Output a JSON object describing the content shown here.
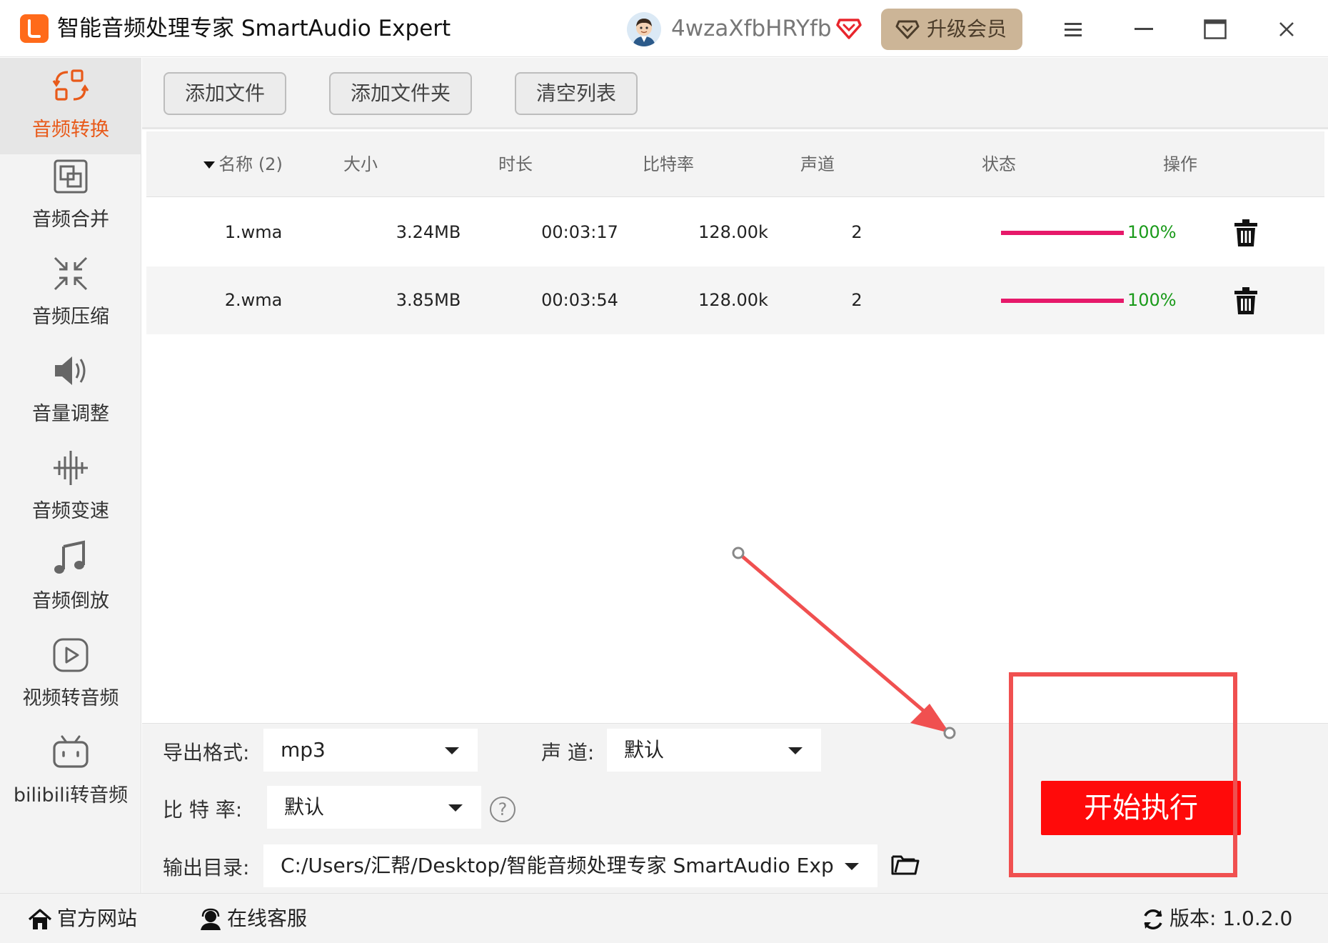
{
  "titlebar": {
    "app_title": "智能音频处理专家 SmartAudio Expert",
    "username": "4wzaXfbHRYfb",
    "upgrade_label": "升级会员"
  },
  "sidebar": {
    "items": [
      {
        "label": "音频转换",
        "icon": "convert-icon",
        "active": true
      },
      {
        "label": "音频合并",
        "icon": "merge-icon"
      },
      {
        "label": "音频压缩",
        "icon": "compress-icon"
      },
      {
        "label": "音量调整",
        "icon": "volume-icon"
      },
      {
        "label": "音频变速",
        "icon": "speed-icon"
      },
      {
        "label": "音频倒放",
        "icon": "music-note-icon"
      },
      {
        "label": "视频转音频",
        "icon": "video-play-icon"
      },
      {
        "label": "bilibili转音频",
        "icon": "bilibili-tv-icon"
      }
    ]
  },
  "toolbar": {
    "add_file": "添加文件",
    "add_folder": "添加文件夹",
    "clear_list": "清空列表"
  },
  "table": {
    "headers": {
      "name": "名称 (2)",
      "size": "大小",
      "duration": "时长",
      "bitrate": "比特率",
      "channels": "声道",
      "status": "状态",
      "action": "操作"
    },
    "rows": [
      {
        "name": "1.wma",
        "size": "3.24MB",
        "duration": "00:03:17",
        "bitrate": "128.00k",
        "channels": "2",
        "progress": 100,
        "progress_text": "100%"
      },
      {
        "name": "2.wma",
        "size": "3.85MB",
        "duration": "00:03:54",
        "bitrate": "128.00k",
        "channels": "2",
        "progress": 100,
        "progress_text": "100%"
      }
    ]
  },
  "settings": {
    "format_label": "导出格式:",
    "format_value": "mp3",
    "channel_label": "声 道:",
    "channel_value": "默认",
    "bitrate_label": "比 特 率:",
    "bitrate_value": "默认",
    "output_label": "输出目录:",
    "output_value": "C:/Users/汇帮/Desktop/智能音频处理专家 SmartAudio Exp",
    "start_label": "开始执行"
  },
  "statusbar": {
    "website": "官方网站",
    "support": "在线客服",
    "version": "版本: 1.0.2.0"
  },
  "colors": {
    "accent": "#e85a1a",
    "progress": "#e6196a",
    "progress_text": "#1a9a1a",
    "start_button": "#ff0a0a",
    "annotation": "#f05050"
  }
}
